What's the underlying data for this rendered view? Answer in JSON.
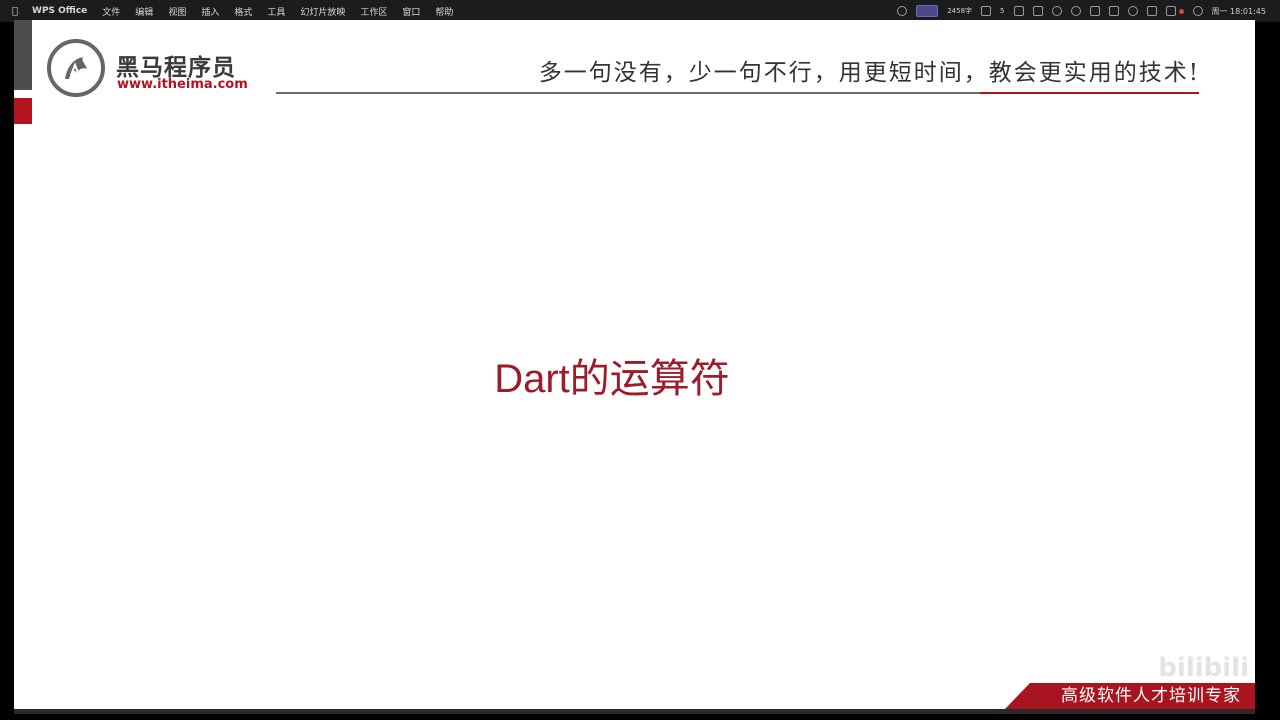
{
  "menubar": {
    "app_name": "WPS Office",
    "items": [
      "文件",
      "编辑",
      "视图",
      "插入",
      "格式",
      "工具",
      "幻灯片放映",
      "工作区",
      "窗口",
      "帮助"
    ],
    "status_text": "2458字",
    "status_count": "5",
    "clock": "周一 18:01:45"
  },
  "header": {
    "brand_cn": "黑马程序员",
    "brand_url": "www.itheima.com",
    "slogan": "多一句没有，少一句不行，用更短时间，教会更实用的技术!"
  },
  "slide": {
    "title": "Dart的运算符"
  },
  "footer": {
    "text": "高级软件人才培训专家",
    "watermark": "bilibili"
  },
  "colors": {
    "brand_red": "#b1141f",
    "title_red": "#9e1b2a",
    "banner_red": "#a8141f"
  }
}
